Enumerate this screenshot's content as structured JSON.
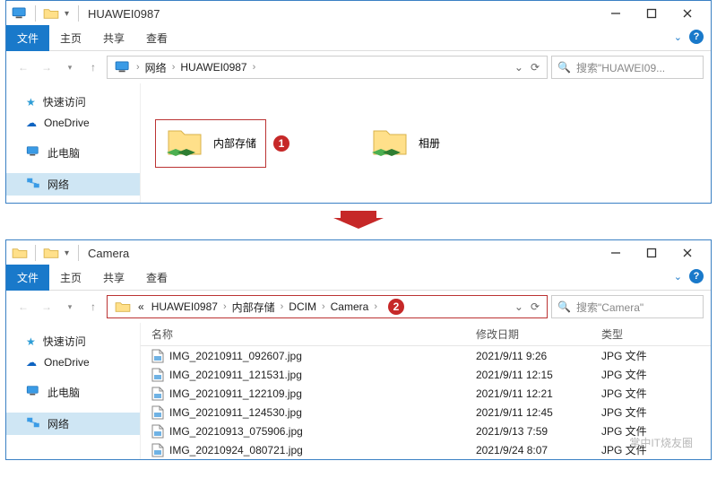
{
  "window1": {
    "title": "HUAWEI0987",
    "ribbon": {
      "file": "文件",
      "home": "主页",
      "share": "共享",
      "view": "查看"
    },
    "breadcrumbs": [
      "网络",
      "HUAWEI0987"
    ],
    "search_placeholder": "搜索\"HUAWEI09...",
    "sidebar": {
      "quick": "快速访问",
      "onedrive": "OneDrive",
      "thispc": "此电脑",
      "network": "网络"
    },
    "folders": {
      "internal": "内部存储",
      "album": "相册"
    },
    "badge1": "1"
  },
  "window2": {
    "title": "Camera",
    "ribbon": {
      "file": "文件",
      "home": "主页",
      "share": "共享",
      "view": "查看"
    },
    "breadcrumbs_prefix": "«",
    "breadcrumbs": [
      "HUAWEI0987",
      "内部存储",
      "DCIM",
      "Camera"
    ],
    "badge2": "2",
    "search_placeholder": "搜索\"Camera\"",
    "sidebar": {
      "quick": "快速访问",
      "onedrive": "OneDrive",
      "thispc": "此电脑",
      "network": "网络"
    },
    "columns": {
      "name": "名称",
      "date": "修改日期",
      "type": "类型"
    },
    "files": [
      {
        "name": "IMG_20210911_092607.jpg",
        "date": "2021/9/11 9:26",
        "type": "JPG 文件"
      },
      {
        "name": "IMG_20210911_121531.jpg",
        "date": "2021/9/11 12:15",
        "type": "JPG 文件"
      },
      {
        "name": "IMG_20210911_122109.jpg",
        "date": "2021/9/11 12:21",
        "type": "JPG 文件"
      },
      {
        "name": "IMG_20210911_124530.jpg",
        "date": "2021/9/11 12:45",
        "type": "JPG 文件"
      },
      {
        "name": "IMG_20210913_075906.jpg",
        "date": "2021/9/13 7:59",
        "type": "JPG 文件"
      },
      {
        "name": "IMG_20210924_080721.jpg",
        "date": "2021/9/24 8:07",
        "type": "JPG 文件"
      }
    ]
  },
  "watermark": "掌中IT烧友圈"
}
